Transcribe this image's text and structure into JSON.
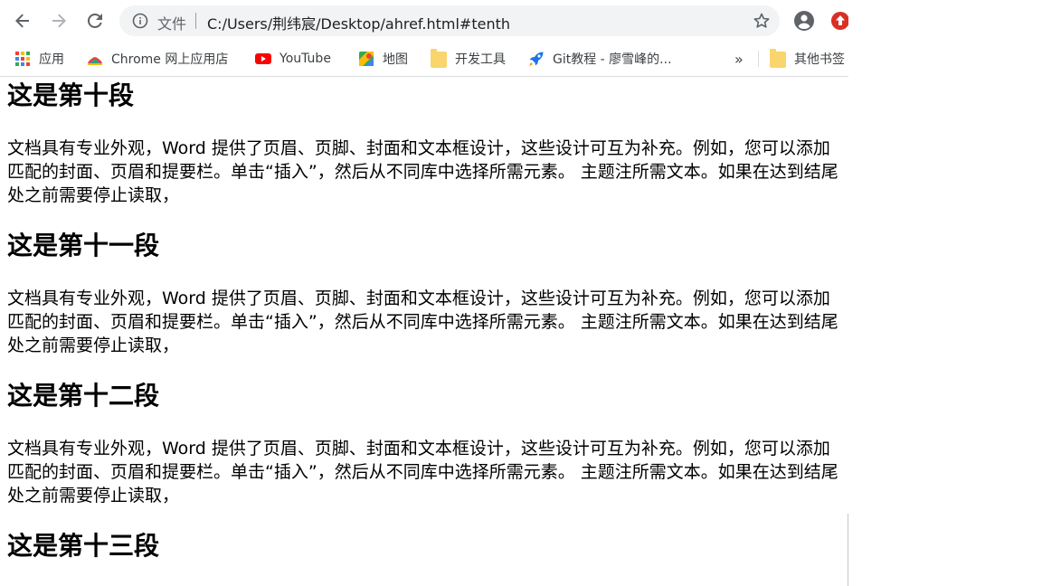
{
  "toolbar": {
    "scheme_label": "文件",
    "url": "C:/Users/荆纬宸/Desktop/ahref.html#tenth",
    "icons": [
      "back-arrow-icon",
      "forward-arrow-icon",
      "reload-icon",
      "info-icon",
      "star-icon",
      "account-icon",
      "extension-icon"
    ]
  },
  "bookmarks": {
    "items": [
      {
        "label": "应用",
        "icon": "apps-grid-icon"
      },
      {
        "label": "Chrome 网上应用店",
        "icon": "chrome-webstore-icon"
      },
      {
        "label": "YouTube",
        "icon": "youtube-icon"
      },
      {
        "label": "地图",
        "icon": "maps-icon"
      },
      {
        "label": "开发工具",
        "icon": "folder-icon"
      },
      {
        "label": "Git教程 - 廖雪峰的...",
        "icon": "rocket-icon"
      }
    ],
    "overflow": "»",
    "other": "其他书签"
  },
  "content": {
    "sections": [
      {
        "heading": "这是第十段",
        "paragraph": "文档具有专业外观，Word 提供了页眉、页脚、封面和文本框设计，这些设计可互为补充。例如，您可以添加匹配的封面、页眉和提要栏。单击“插入”，然后从不同库中选择所需元素。 主题注所需文本。如果在达到结尾处之前需要停止读取，"
      },
      {
        "heading": "这是第十一段",
        "paragraph": "文档具有专业外观，Word 提供了页眉、页脚、封面和文本框设计，这些设计可互为补充。例如，您可以添加匹配的封面、页眉和提要栏。单击“插入”，然后从不同库中选择所需元素。 主题注所需文本。如果在达到结尾处之前需要停止读取，"
      },
      {
        "heading": "这是第十二段",
        "paragraph": "文档具有专业外观，Word 提供了页眉、页脚、封面和文本框设计，这些设计可互为补充。例如，您可以添加匹配的封面、页眉和提要栏。单击“插入”，然后从不同库中选择所需元素。 主题注所需文本。如果在达到结尾处之前需要停止读取，"
      },
      {
        "heading": "这是第十三段"
      }
    ]
  },
  "colors": {
    "omnibox_bg": "#f1f3f4",
    "extension_red": "#d93025",
    "youtube_red": "#ff0000",
    "folder_yellow": "#f9d56e"
  }
}
